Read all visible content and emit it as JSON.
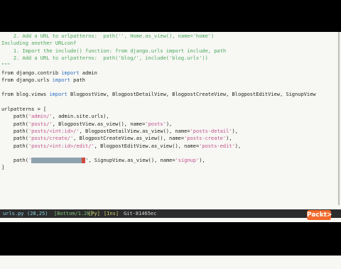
{
  "editor": {
    "lines": [
      {
        "segs": [
          {
            "t": "    2. Add a URL to urlpatterns:  path('', Home.as_view(), name='home')",
            "c": "c-doc"
          }
        ]
      },
      {
        "segs": [
          {
            "t": "Including another URLconf",
            "c": "c-doc"
          }
        ]
      },
      {
        "segs": [
          {
            "t": "    1. Import the include() function: from django.urls import include, path",
            "c": "c-doc"
          }
        ]
      },
      {
        "segs": [
          {
            "t": "    2. Add a URL to urlpatterns:  path('blog/', include('blog.urls'))",
            "c": "c-doc"
          }
        ]
      },
      {
        "segs": [
          {
            "t": "\"\"\"",
            "c": "c-doc"
          }
        ]
      },
      {
        "segs": [
          {
            "t": "from ",
            "c": ""
          },
          {
            "t": "django.contrib ",
            "c": ""
          },
          {
            "t": "import",
            "c": "c-kw"
          },
          {
            "t": " admin",
            "c": ""
          }
        ]
      },
      {
        "segs": [
          {
            "t": "from ",
            "c": ""
          },
          {
            "t": "django.urls ",
            "c": ""
          },
          {
            "t": "import",
            "c": "c-kw"
          },
          {
            "t": " path",
            "c": ""
          }
        ]
      },
      {
        "segs": [
          {
            "t": "",
            "c": ""
          }
        ]
      },
      {
        "segs": [
          {
            "t": "from ",
            "c": ""
          },
          {
            "t": "blog.views ",
            "c": ""
          },
          {
            "t": "import",
            "c": "c-kw"
          },
          {
            "t": " BlogpostView, BlogpostDetailView, BlogpostCreateView, BlogpostEditView, SignupView",
            "c": ""
          }
        ]
      },
      {
        "segs": [
          {
            "t": "",
            "c": ""
          }
        ]
      },
      {
        "segs": [
          {
            "t": "urlpatterns = [",
            "c": ""
          }
        ]
      },
      {
        "segs": [
          {
            "t": "    path(",
            "c": ""
          },
          {
            "t": "'admin/'",
            "c": "c-str"
          },
          {
            "t": ", admin.site.urls),",
            "c": ""
          }
        ]
      },
      {
        "segs": [
          {
            "t": "    path(",
            "c": ""
          },
          {
            "t": "'posts/'",
            "c": "c-str"
          },
          {
            "t": ", BlogpostView.as_view(), name=",
            "c": ""
          },
          {
            "t": "'posts'",
            "c": "c-str"
          },
          {
            "t": "),",
            "c": ""
          }
        ]
      },
      {
        "segs": [
          {
            "t": "    path(",
            "c": ""
          },
          {
            "t": "'posts/<int:id>/'",
            "c": "c-str"
          },
          {
            "t": ", BlogpostDetailView.as_view(), name=",
            "c": ""
          },
          {
            "t": "'posts-detail'",
            "c": "c-str"
          },
          {
            "t": "),",
            "c": ""
          }
        ]
      },
      {
        "segs": [
          {
            "t": "    path(",
            "c": ""
          },
          {
            "t": "'posts/create/'",
            "c": "c-str"
          },
          {
            "t": ", BlogpostCreateView.as_view(), name=",
            "c": ""
          },
          {
            "t": "'posts-create'",
            "c": "c-str"
          },
          {
            "t": "),",
            "c": ""
          }
        ]
      },
      {
        "segs": [
          {
            "t": "    path(",
            "c": ""
          },
          {
            "t": "'posts/<int:id>/edit/'",
            "c": "c-str"
          },
          {
            "t": ", BlogpostEditView.as_view(), name=",
            "c": ""
          },
          {
            "t": "'posts-edit'",
            "c": "c-str"
          },
          {
            "t": "),",
            "c": ""
          }
        ]
      },
      {
        "segs": [
          {
            "t": "",
            "c": ""
          }
        ]
      },
      {
        "cursor_line": true,
        "segs": [
          {
            "t": "    path(",
            "c": ""
          },
          {
            "t": "'",
            "c": "c-str"
          }
        ],
        "after": [
          {
            "t": "', SignupView.as_view(), name=",
            "c": ""
          },
          {
            "t": "'signup'",
            "c": "c-str"
          },
          {
            "t": "),",
            "c": ""
          }
        ]
      },
      {
        "segs": [
          {
            "t": "]",
            "c": ""
          }
        ]
      }
    ]
  },
  "status": {
    "file": "urls.py",
    "position": "(28,25)",
    "where": "[Bottom/1.2k]",
    "filetype": "[Py]",
    "mode": "[Ins]",
    "git": "Git-81465ec"
  },
  "brand": {
    "logo_text": "Packt>"
  },
  "colors": {
    "accent": "#f26b2d",
    "selection": "#8ea2ad",
    "caret": "#d04a3d"
  }
}
